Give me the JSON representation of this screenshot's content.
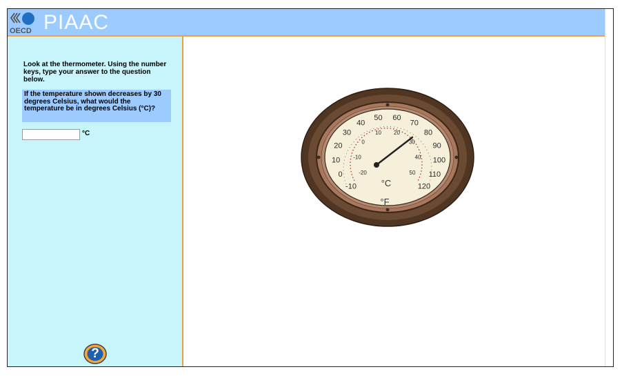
{
  "header": {
    "brand": "OECD",
    "app_title": "PIAAC",
    "logo_icon": "oecd-logo-icon"
  },
  "sidebar": {
    "instruction": "Look at the thermometer. Using the number keys, type your answer to the question below.",
    "question": "If the temperature shown decreases by 30 degrees Celsius, what would the temperature be in degrees Celsius (°C)?",
    "answer": {
      "value": "",
      "placeholder": "",
      "unit": "°C"
    },
    "help": {
      "label": "?",
      "icon": "help-icon"
    }
  },
  "thermometer": {
    "fahrenheit_ticks": [
      "-10",
      "0",
      "10",
      "20",
      "30",
      "40",
      "50",
      "60",
      "70",
      "80",
      "90",
      "100",
      "110",
      "120"
    ],
    "celsius_ticks": [
      "-20",
      "-10",
      "0",
      "10",
      "20",
      "30",
      "40",
      "50"
    ],
    "celsius_label": "°C",
    "fahrenheit_label": "°F",
    "reading_celsius": 30,
    "colors": {
      "rim": "#5a3d28",
      "face": "#f6efd9",
      "tick_red": "#b22222",
      "accent": "#f0a040",
      "header": "#9ccbff",
      "sidebar": "#c8f4fb"
    }
  }
}
